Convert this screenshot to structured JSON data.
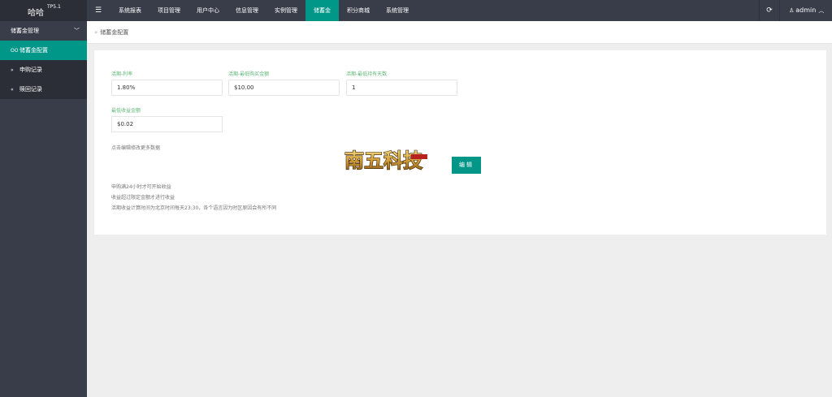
{
  "header": {
    "app_name": "哈哈",
    "version": "TP5.1",
    "menu_icon": "hamburger-icon",
    "nav": [
      {
        "label": "系统报表"
      },
      {
        "label": "项目管理"
      },
      {
        "label": "用户中心"
      },
      {
        "label": "信息管理"
      },
      {
        "label": "实例管理"
      },
      {
        "label": "储蓄金",
        "active": true
      },
      {
        "label": "积分商城"
      },
      {
        "label": "系统管理"
      }
    ],
    "refresh_icon": "refresh-icon",
    "user": {
      "name": "admin",
      "icon": "user-icon",
      "caret": "chevron-up-icon"
    }
  },
  "sidebar": {
    "group_label": "储蓄金管理",
    "group_icon": "chevron-down-icon",
    "items": [
      {
        "label": "储蓄金配置",
        "prefix": "OO",
        "active": true
      },
      {
        "label": "申购记录",
        "prefix": "»"
      },
      {
        "label": "赎回记录",
        "prefix": "«"
      }
    ]
  },
  "breadcrumb": {
    "arrow": "»",
    "label": "储蓄金配置"
  },
  "form": {
    "fields": [
      {
        "label": "活期-利率",
        "value": "1.80%"
      },
      {
        "label": "活期-最低购买金额",
        "value": "$10.00"
      },
      {
        "label": "活期-最低持有天数",
        "value": "1"
      },
      {
        "label": "最低收益金额",
        "value": "$0.02"
      }
    ],
    "hint": "点击编辑修改更多数据",
    "edit_label": "编辑",
    "notes": [
      "申购满24小时才可开始收益",
      "收益超过限定金额才进行收益",
      "活期收益计算时间为北京时间每天23:30，各个语言因为时区原因会有所不同"
    ]
  },
  "watermark": {
    "text": "南五科技",
    "badge": "精品源码"
  }
}
